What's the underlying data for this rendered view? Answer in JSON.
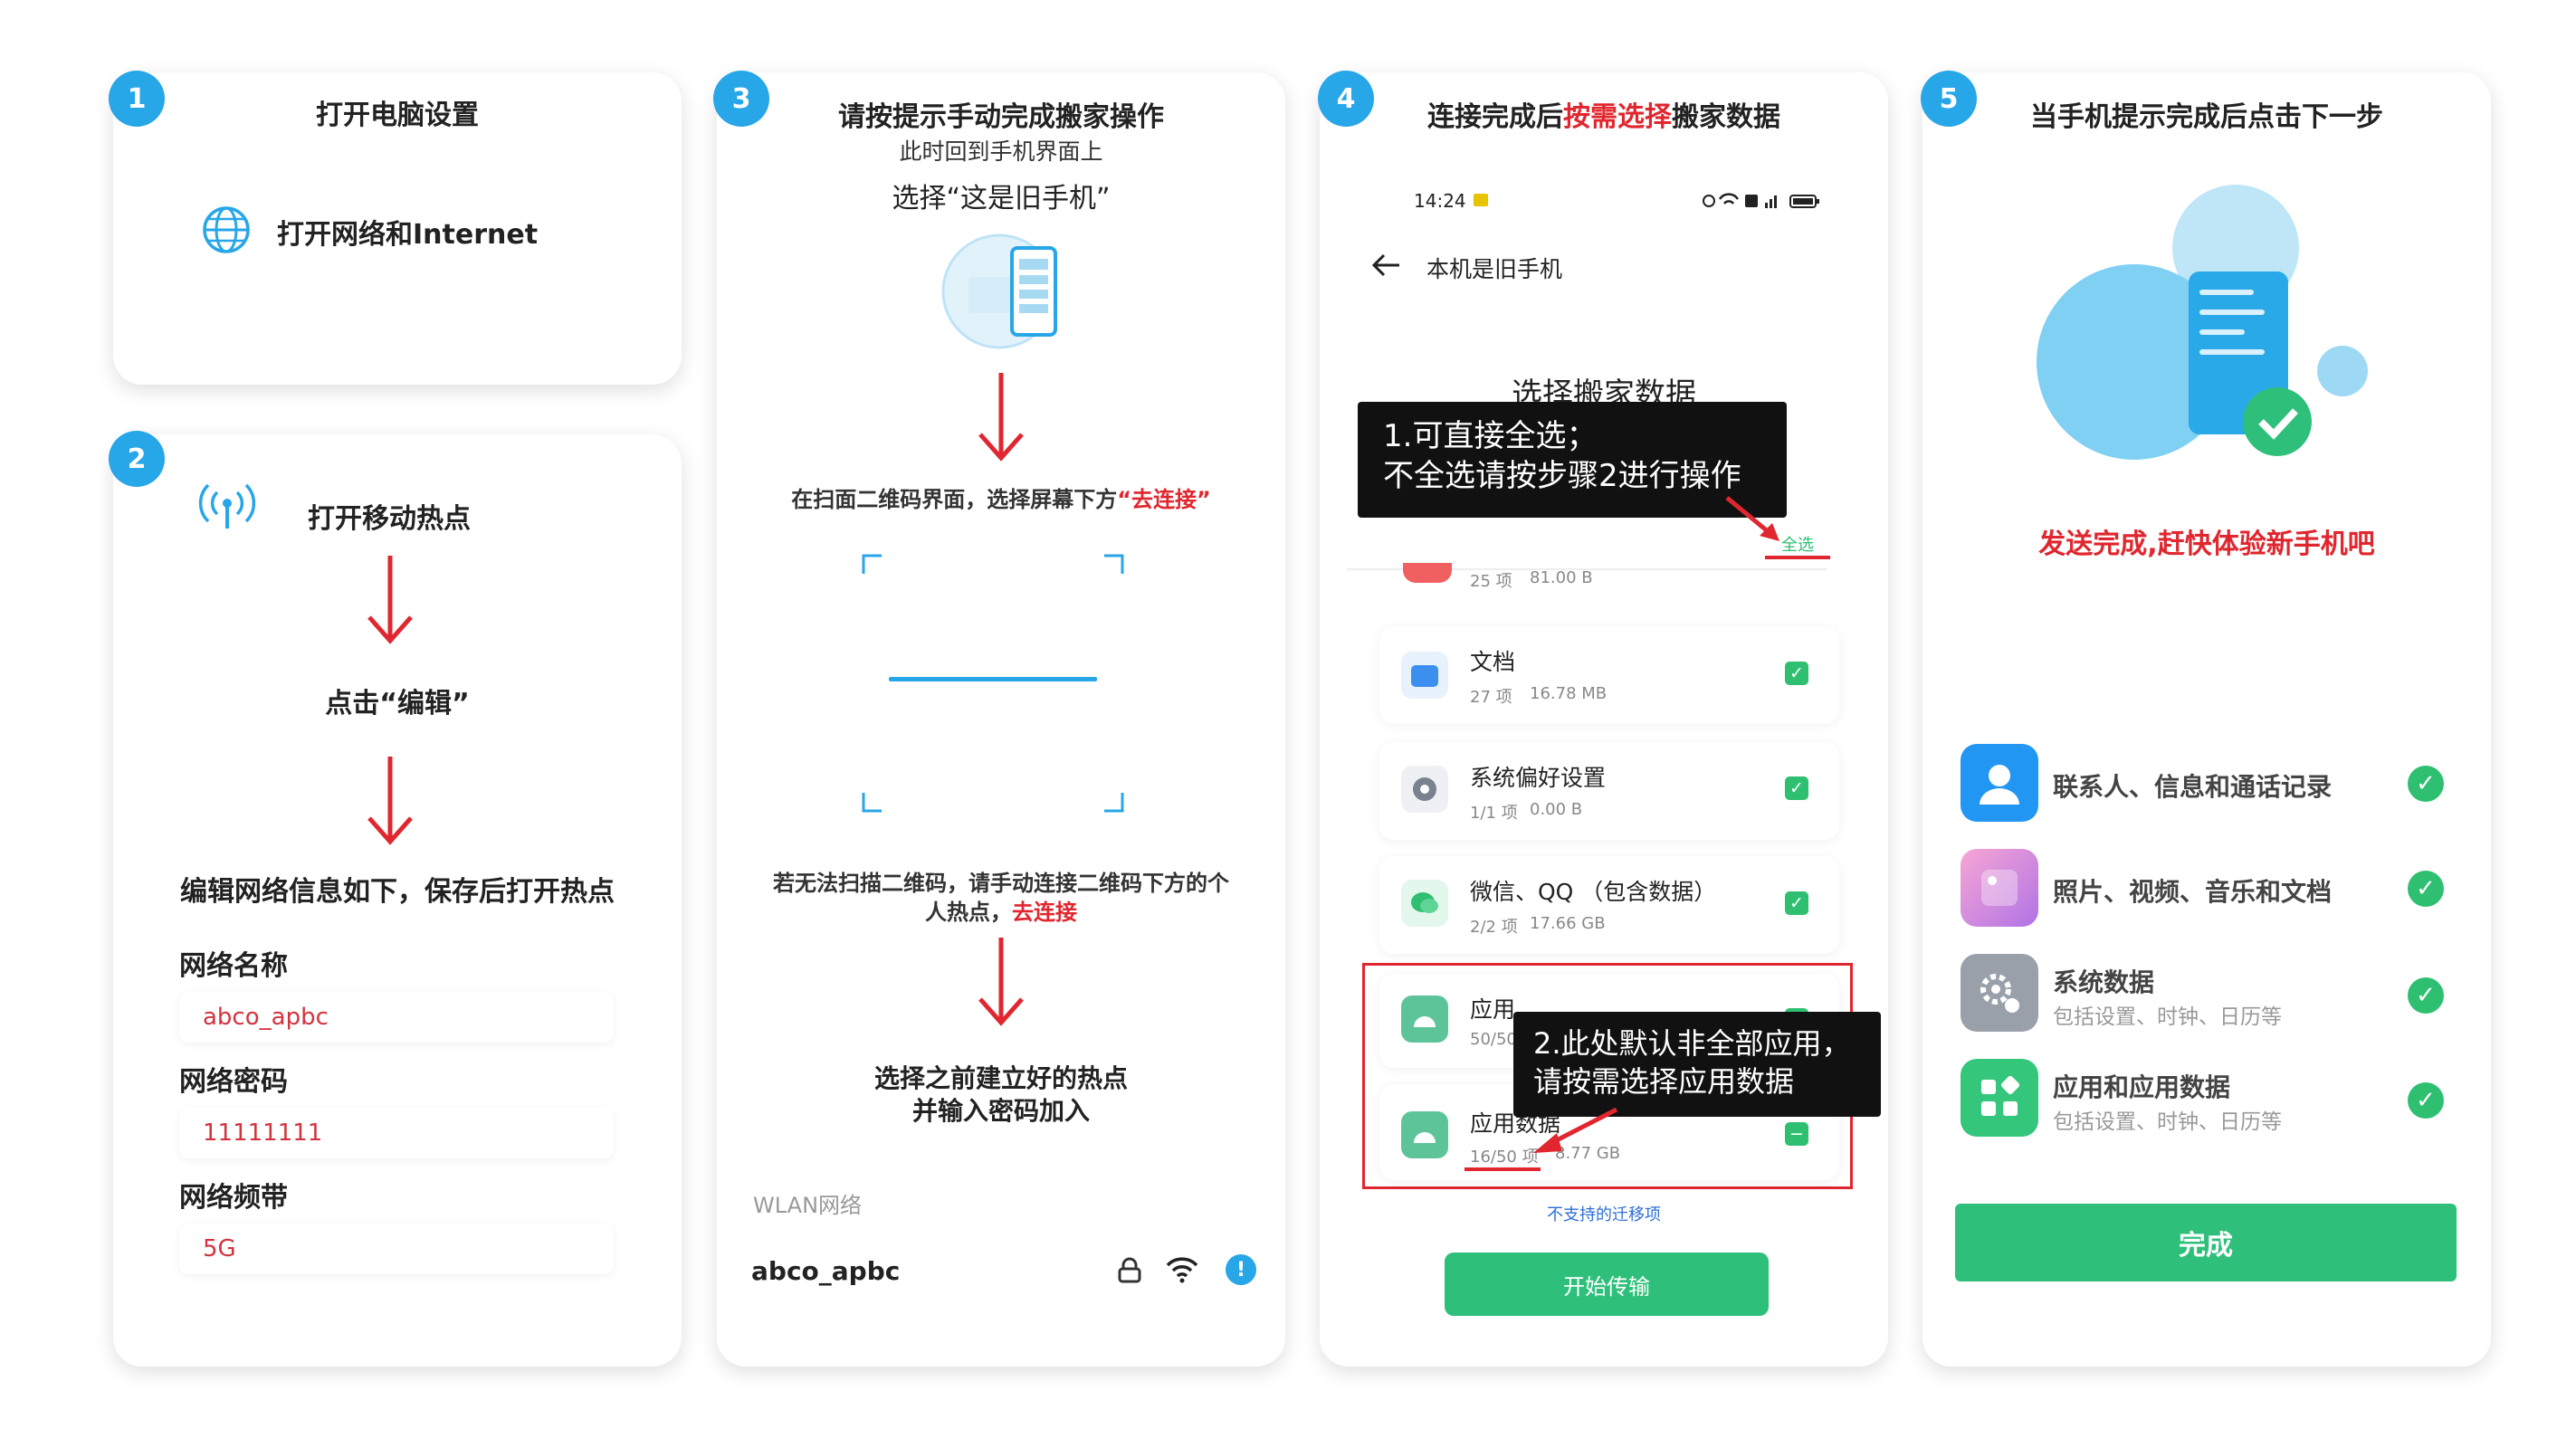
{
  "step1": {
    "badge": "1",
    "title": "打开电脑设置",
    "item": "打开网络和Internet"
  },
  "step2": {
    "badge": "2",
    "hotspot": "打开移动热点",
    "click_edit": "点击“编辑”",
    "instruction": "编辑网络信息如下，保存后打开热点",
    "name_label": "网络名称",
    "name_value": "abco_apbc",
    "pwd_label": "网络密码",
    "pwd_value": "11111111",
    "band_label": "网络频带",
    "band_value": "5G"
  },
  "step3": {
    "badge": "3",
    "title": "请按提示手动完成搬家操作",
    "subtitle": "此时回到手机界面上",
    "choose_old": "选择“这是旧手机”",
    "scan_text_pre": "在扫面二维码界面，选择屏幕下方",
    "scan_text_link": "“去连接”",
    "manual_line1": "若无法扫描二维码，请手动连接二维码下方的个",
    "manual_line2_pre": "人热点，",
    "manual_line2_link": "去连接",
    "join_line1": "选择之前建立好的热点",
    "join_line2": "并输入密码加入",
    "wlan_label": "WLAN网络",
    "network_name": "abco_apbc",
    "info_icon_glyph": "!"
  },
  "step4": {
    "badge": "4",
    "title_pre": "连接完成后",
    "title_highlight": "按需选择",
    "title_post": "搬家数据",
    "time": "14:24",
    "back_title": "本机是旧手机",
    "heading": "选择搬家数据",
    "callout1_line1": "1.可直接全选；",
    "callout1_line2": "不全选请按步骤2进行操作",
    "select_all": "全选",
    "partial": {
      "count": "25 项",
      "size": "81.00 B"
    },
    "items": [
      {
        "name": "文档",
        "count": "27 项",
        "size": "16.78 MB"
      },
      {
        "name": "系统偏好设置",
        "count": "1/1 项",
        "size": "0.00 B"
      },
      {
        "name": "微信、QQ （包含数据）",
        "count": "2/2 项",
        "size": "17.66 GB"
      }
    ],
    "app_item": {
      "name": "应用",
      "count": "50/50"
    },
    "appdata_item": {
      "name": "应用数据",
      "count": "16/50 项",
      "size": "8.77 GB"
    },
    "callout2_line1": "2.此处默认非全部应用，",
    "callout2_line2": "请按需选择应用数据",
    "unsupported": "不支持的迁移项",
    "start_button": "开始传输"
  },
  "step5": {
    "badge": "5",
    "title": "当手机提示完成后点击下一步",
    "done_text": "发送完成,赶快体验新手机吧",
    "items": [
      {
        "name": "联系人、信息和通话记录",
        "sub": ""
      },
      {
        "name": "照片、视频、音乐和文档",
        "sub": ""
      },
      {
        "name": "系统数据",
        "sub": "包括设置、时钟、日历等"
      },
      {
        "name": "应用和应用数据",
        "sub": "包括设置、时钟、日历等"
      }
    ],
    "finish_button": "完成"
  },
  "colors": {
    "accent_blue": "#27a6e8",
    "green": "#2ec07a",
    "red": "#e0262e",
    "callout_bg": "#111111"
  }
}
